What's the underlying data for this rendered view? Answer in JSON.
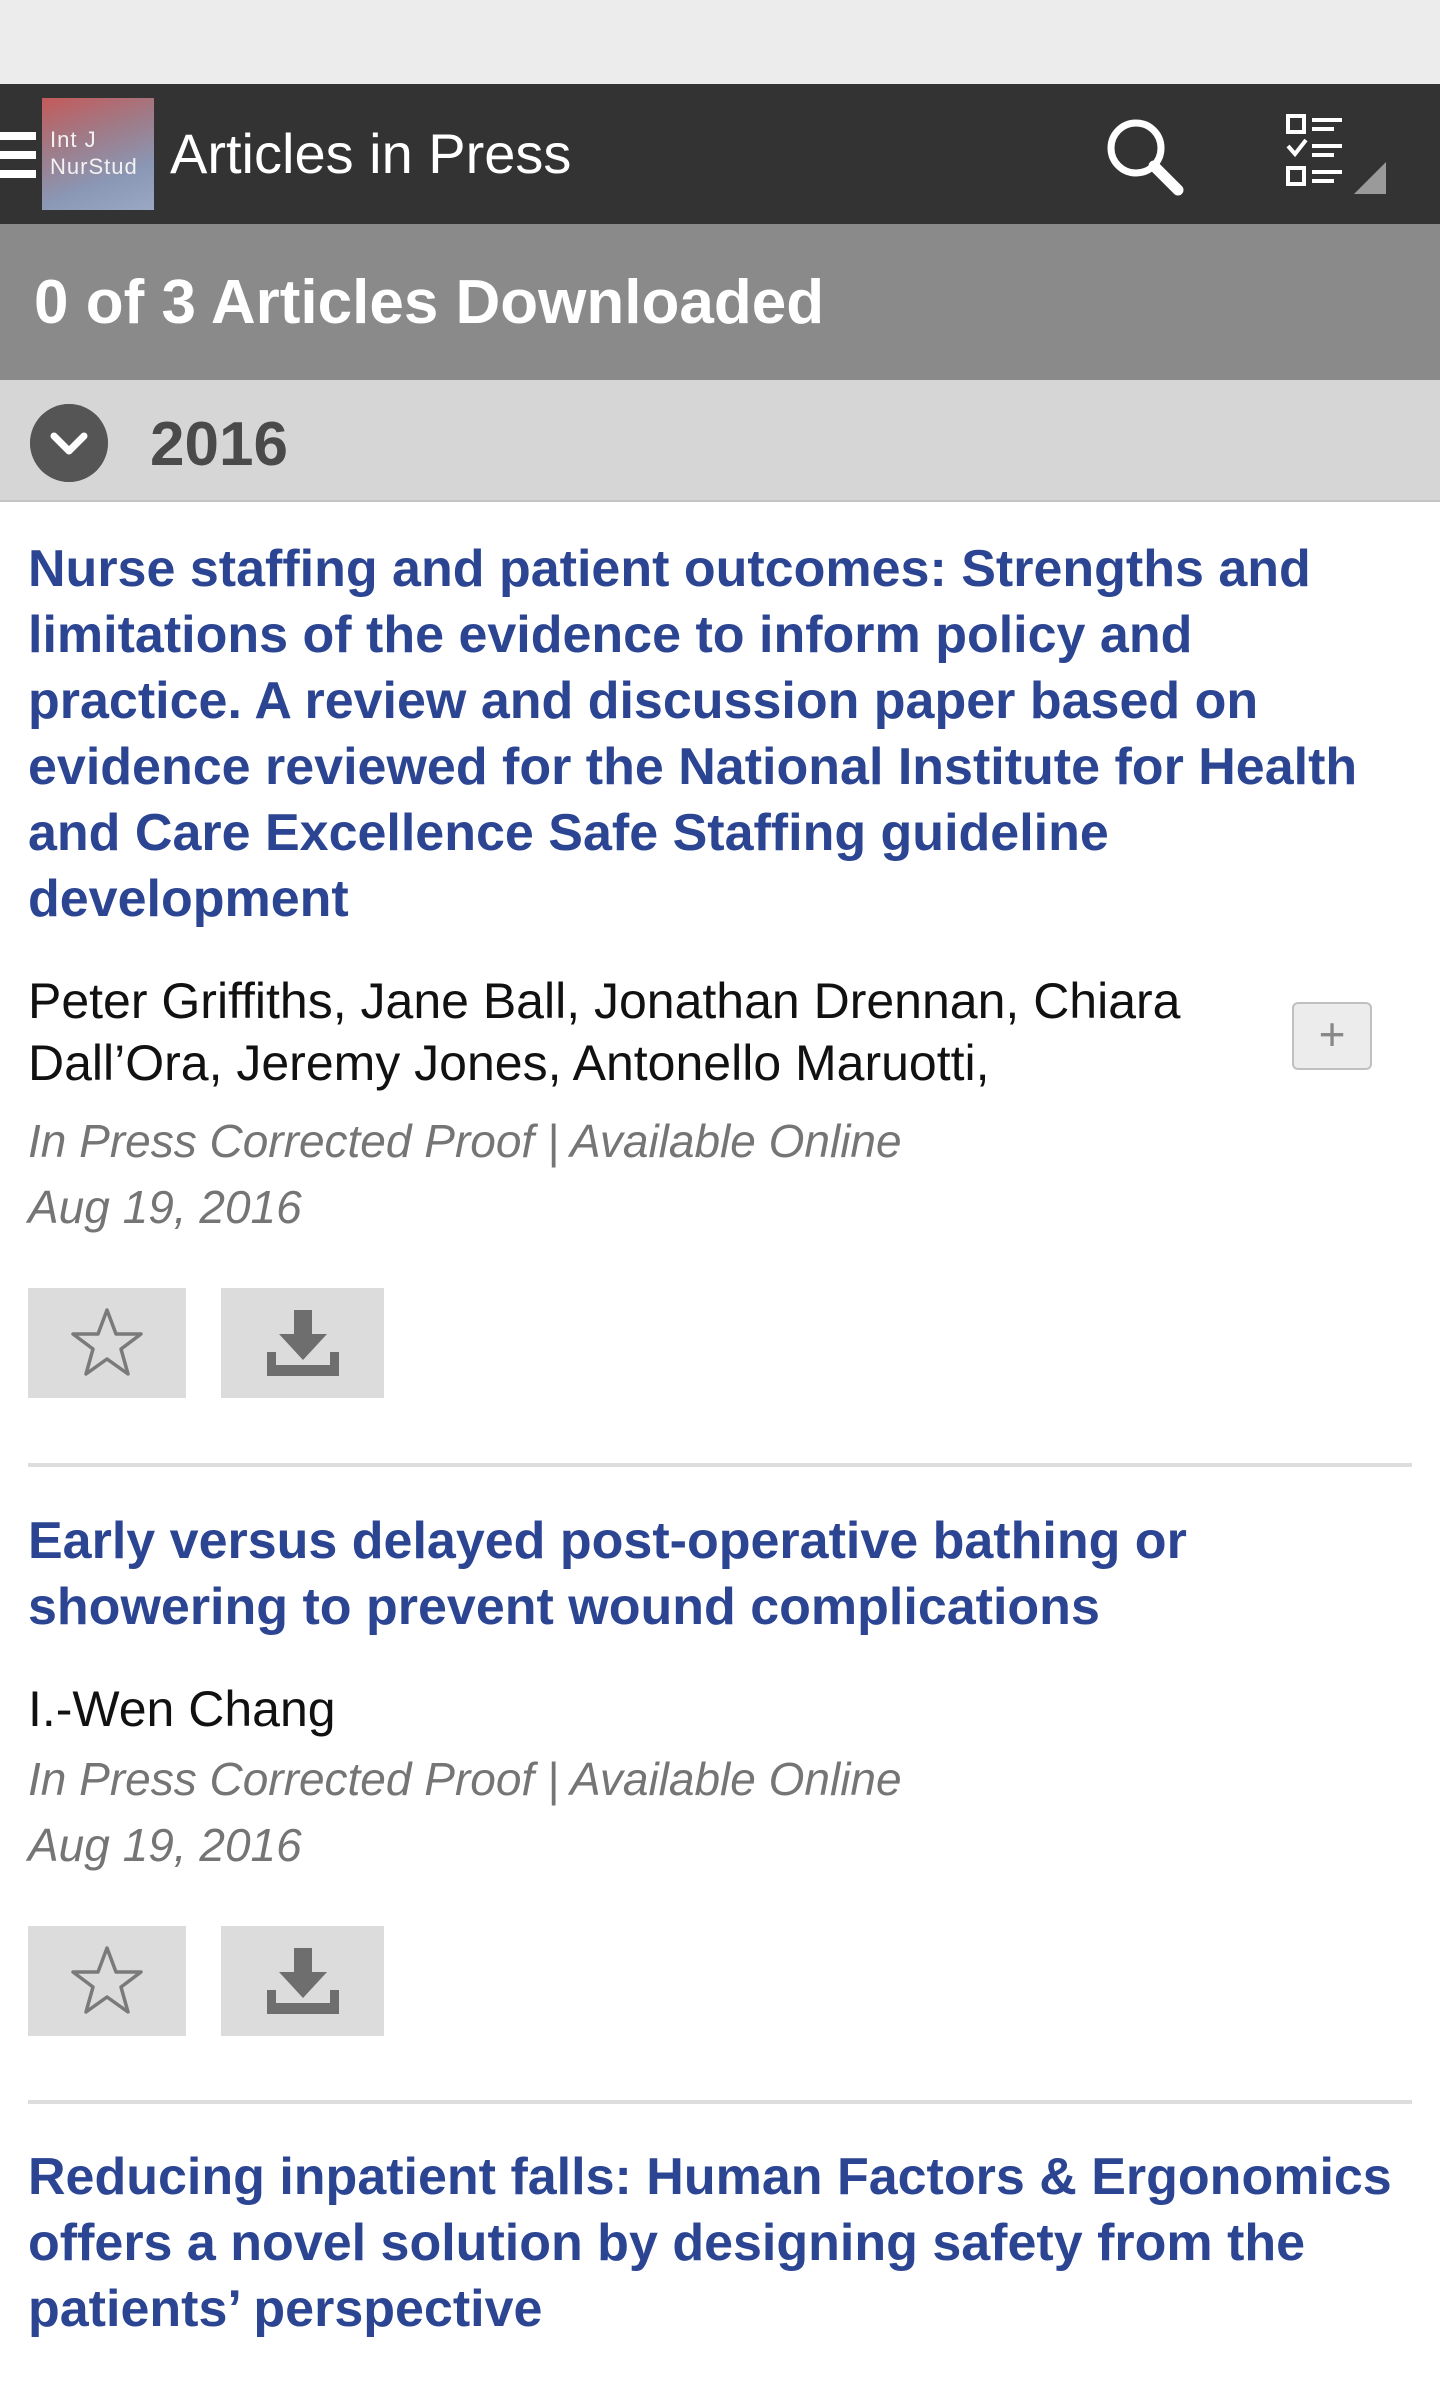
{
  "app_bar": {
    "logo_line1": "Int J",
    "logo_line2": "NurStud",
    "title": "Articles in Press",
    "icons": [
      "menu-icon",
      "search-icon",
      "filter-list-icon"
    ]
  },
  "downloads": {
    "summary": "0 of 3 Articles Downloaded"
  },
  "section": {
    "year": "2016"
  },
  "articles": [
    {
      "title": "Nurse staffing and patient outcomes: Strengths and limitations of the evidence to inform policy and practice. A review and discussion paper based on evidence reviewed for the National Institute for Health and Care Excellence Safe Staffing guideline development",
      "authors": "Peter Griffiths, Jane Ball, Jonathan Drennan, Chiara Dall’Ora, Jeremy Jones, Antonello Maruotti,",
      "expand_label": "+",
      "status": "In Press Corrected Proof | Available Online",
      "date": "Aug 19, 2016"
    },
    {
      "title": "Early versus delayed post-operative bathing or showering to prevent wound complications",
      "authors": "I.-Wen Chang",
      "status": "In Press Corrected Proof | Available Online",
      "date": "Aug 19, 2016"
    },
    {
      "title": "Reducing inpatient falls: Human Factors & Ergonomics offers a novel solution by designing safety from the patients’ perspective"
    }
  ],
  "colors": {
    "app_bar": "#333333",
    "banner": "#8a8a8a",
    "year_header": "#d6d6d6",
    "title_link": "#2c4592",
    "meta_text": "#757575"
  }
}
